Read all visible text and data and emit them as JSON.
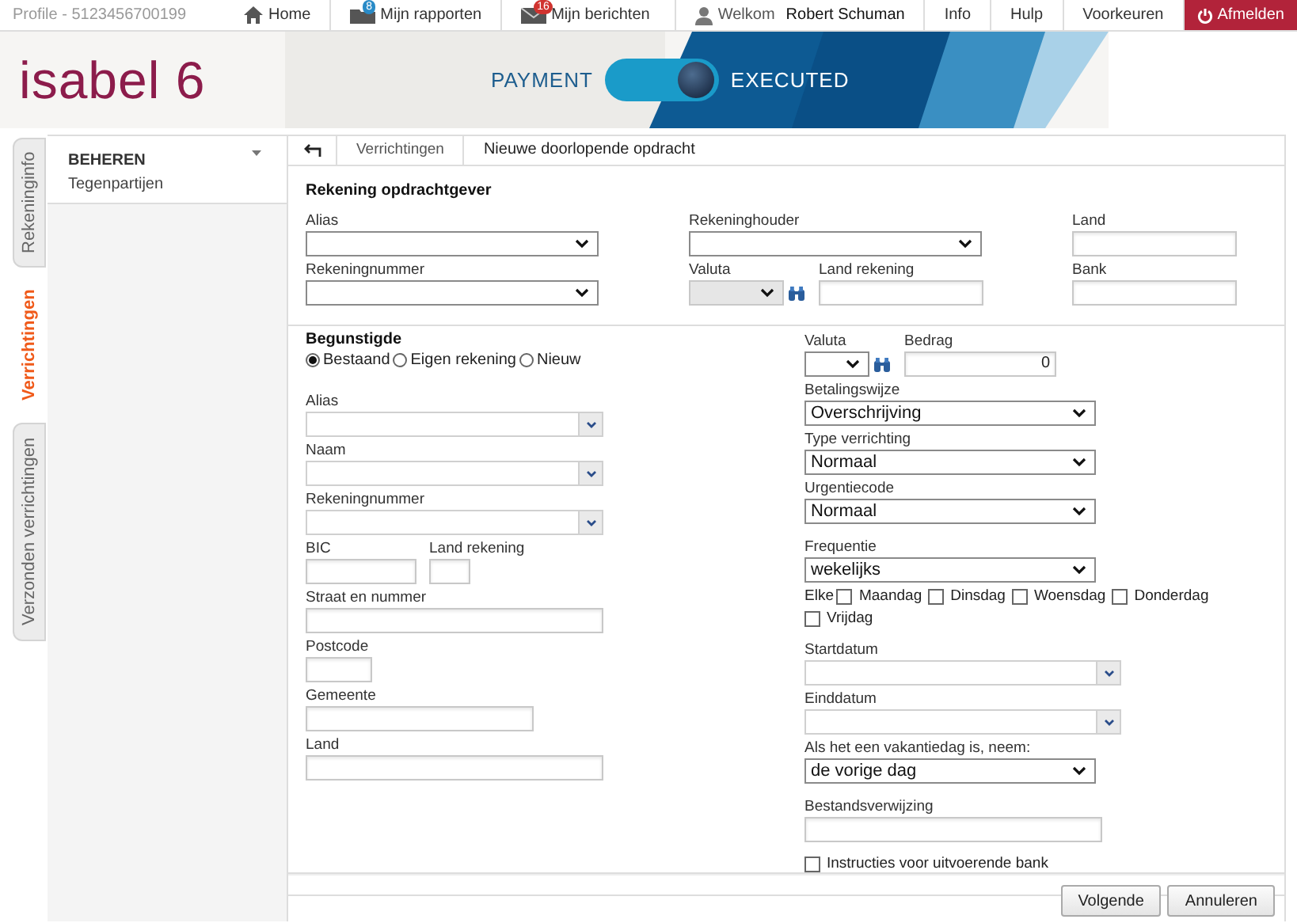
{
  "topbar": {
    "profile": "Profile - 5123456700199",
    "nav": [
      {
        "kind": "home",
        "label": "Home"
      },
      {
        "kind": "reports",
        "label": "Mijn rapporten",
        "badge": "8"
      },
      {
        "kind": "messages",
        "label": "Mijn berichten",
        "badge": "16"
      },
      {
        "kind": "user",
        "label": "Welkom",
        "user": "Robert Schuman"
      },
      {
        "kind": "plain",
        "label": "Info"
      },
      {
        "kind": "plain",
        "label": "Hulp"
      },
      {
        "kind": "plain",
        "label": "Voorkeuren"
      },
      {
        "kind": "logout",
        "label": "Afmelden"
      }
    ]
  },
  "banner": {
    "logo": "isabel 6",
    "toggle_left": "PAYMENT",
    "toggle_right": "EXECUTED",
    "toggle_on": true
  },
  "side_tabs": [
    {
      "label": "Rekeninginfo",
      "selected": false
    },
    {
      "label": "Verrichtingen",
      "selected": true
    },
    {
      "label": "Verzonden verrichtingen",
      "selected": false
    }
  ],
  "sidebar": {
    "heading": "BEHEREN",
    "items": [
      "Tegenpartijen"
    ]
  },
  "breadcrumb": [
    "Verrichtingen",
    "Nieuwe doorlopende opdracht"
  ],
  "payer": {
    "title": "Rekening opdrachtgever",
    "fields": [
      {
        "label": "Alias",
        "kind": "select"
      },
      {
        "label": "Rekeningnummer",
        "kind": "select"
      },
      {
        "label": "Rekeninghouder",
        "kind": "select"
      },
      {
        "label": "Valuta",
        "kind": "select",
        "disabled": true
      },
      {
        "label": "Land rekening",
        "kind": "text"
      },
      {
        "label": "Land",
        "kind": "text"
      },
      {
        "label": "Bank",
        "kind": "text"
      }
    ]
  },
  "beneficiary": {
    "title": "Begunstigde",
    "options": [
      {
        "label": "Bestaand",
        "selected": true
      },
      {
        "label": "Eigen rekening",
        "selected": false
      },
      {
        "label": "Nieuw",
        "selected": false
      }
    ],
    "fields": [
      {
        "label": "Alias",
        "kind": "combo"
      },
      {
        "label": "Naam",
        "kind": "combo"
      },
      {
        "label": "Rekeningnummer",
        "kind": "combo"
      },
      {
        "label": "BIC",
        "kind": "text"
      },
      {
        "label": "Land rekening",
        "kind": "text"
      },
      {
        "label": "Straat en nummer",
        "kind": "text"
      },
      {
        "label": "Postcode",
        "kind": "text"
      },
      {
        "label": "Gemeente",
        "kind": "text"
      },
      {
        "label": "Land",
        "kind": "text"
      }
    ]
  },
  "order": {
    "fields": [
      {
        "label": "Valuta",
        "kind": "select",
        "disabled": false
      },
      {
        "label": "Bedrag",
        "kind": "text",
        "value": "0"
      },
      {
        "label": "Betalingswijze",
        "kind": "select",
        "value": "Overschrijving"
      },
      {
        "label": "Type verrichting",
        "kind": "select",
        "value": "Normaal"
      },
      {
        "label": "Urgentiecode",
        "kind": "select",
        "value": "Normaal"
      },
      {
        "label": "Frequentie",
        "kind": "select",
        "value": "wekelijks"
      }
    ],
    "days_prefix": "Elke",
    "days": [
      {
        "label": "Maandag",
        "checked": false
      },
      {
        "label": "Dinsdag",
        "checked": false
      },
      {
        "label": "Woensdag",
        "checked": false
      },
      {
        "label": "Donderdag",
        "checked": false
      },
      {
        "label": "Vrijdag",
        "checked": false
      }
    ],
    "more_fields": [
      {
        "label": "Startdatum",
        "kind": "combo"
      },
      {
        "label": "Einddatum",
        "kind": "combo"
      },
      {
        "label": "Als het een vakantiedag is, neem:",
        "kind": "select",
        "value": "de vorige dag"
      },
      {
        "label": "Bestandsverwijzing",
        "kind": "text"
      }
    ],
    "instructions": {
      "label": "Instructies voor uitvoerende bank",
      "checked": false
    }
  },
  "buttons": [
    "Volgende",
    "Annuleren"
  ]
}
